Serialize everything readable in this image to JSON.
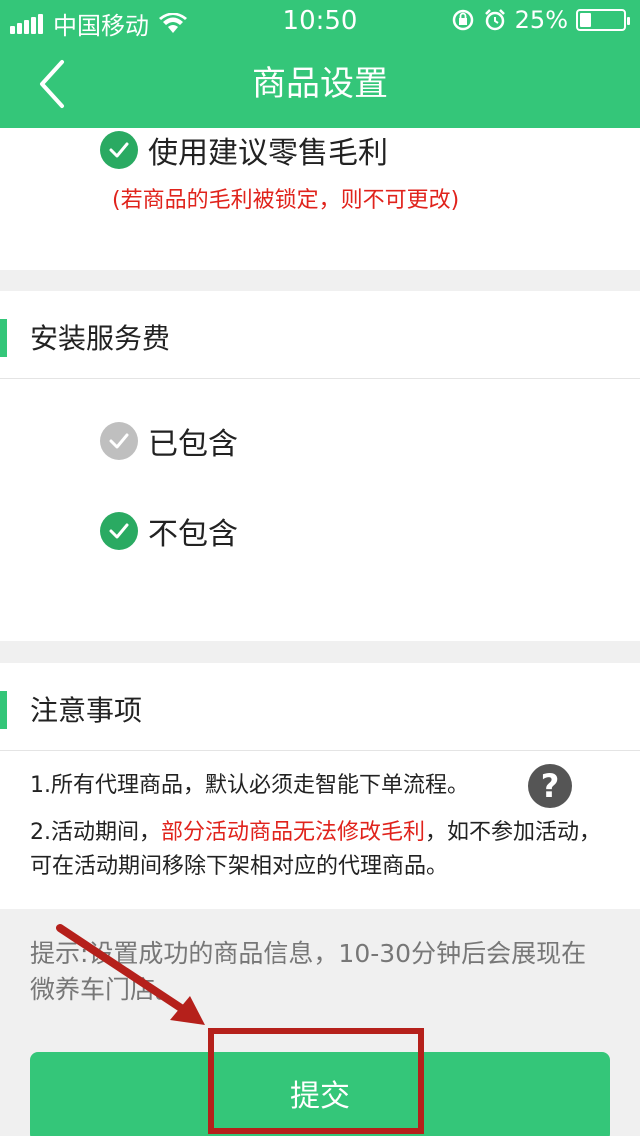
{
  "status_bar": {
    "carrier": "中国移动",
    "time": "10:50",
    "battery": "25%",
    "battery_level": 0.25,
    "icons": [
      "signal-icon",
      "wifi-icon",
      "rotation-lock-icon",
      "alarm-icon",
      "battery-icon"
    ]
  },
  "nav": {
    "title": "商品设置",
    "back_icon": "chevron-left-icon"
  },
  "margin_section": {
    "option_label": "使用建议零售毛利",
    "checked": true,
    "note": "(若商品的毛利被锁定，则不可更改)"
  },
  "install_fee": {
    "title": "安装服务费",
    "options": [
      {
        "label": "已包含",
        "checked": false
      },
      {
        "label": "不包含",
        "checked": true
      }
    ]
  },
  "notes": {
    "title": "注意事项",
    "item1": "1.所有代理商品，默认必须走智能下单流程。",
    "item2_prefix": "2.活动期间，",
    "item2_highlight": "部分活动商品无法修改毛利",
    "item2_suffix": "，如不参加活动，可在活动期间移除下架相对应的代理商品。",
    "help_icon": "question-circle-icon",
    "help_glyph": "?"
  },
  "tip": "提示:设置成功的商品信息，10-30分钟后会展现在微养车门店。",
  "submit_label": "提交",
  "colors": {
    "primary": "#34c679",
    "check_on": "#2aaa62",
    "check_off": "#bfbfbf",
    "warning_text": "#e0231c",
    "annotation": "#b5201b"
  }
}
